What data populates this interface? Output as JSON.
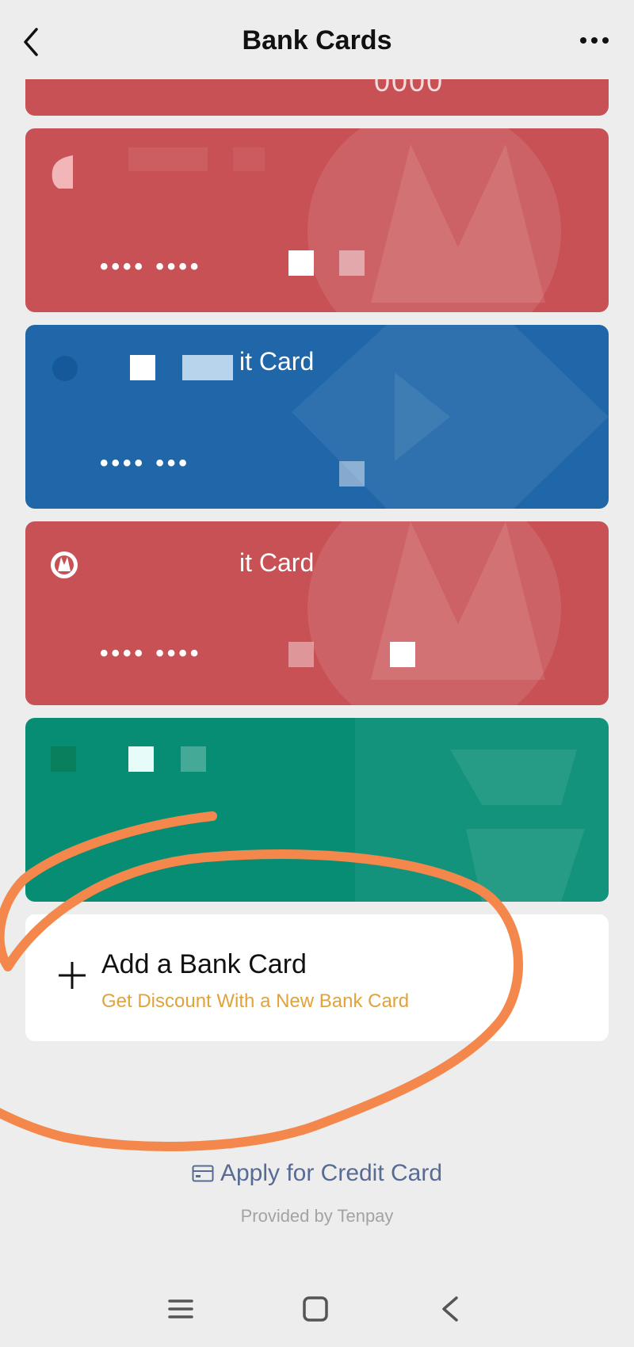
{
  "header": {
    "title": "Bank Cards",
    "back_icon": "chevron-left-icon",
    "more_icon": "more-dots-icon"
  },
  "top_sliver": {
    "text": "0000",
    "color": "#c85155"
  },
  "cards": [
    {
      "name": "",
      "number": "•••• ••••",
      "color": "#c85155"
    },
    {
      "name": "it Card",
      "number": "•••• •••",
      "color": "#1f67a8"
    },
    {
      "name": "it Card",
      "number": "•••• ••••",
      "color": "#c85155"
    },
    {
      "name": "",
      "number": "",
      "color": "#068d74"
    }
  ],
  "add_card": {
    "title": "Add a Bank Card",
    "subtitle": "Get Discount With a New Bank Card",
    "icon": "plus-icon"
  },
  "apply": {
    "label": "Apply for Credit Card",
    "icon": "credit-card-icon"
  },
  "provided_by": "Provided by Tenpay",
  "system_nav": {
    "menu_icon": "menu-icon",
    "home_icon": "home-square-icon",
    "back_icon": "back-triangle-icon"
  },
  "colors": {
    "background": "#ededed",
    "red_card": "#c85155",
    "blue_card": "#1f67a8",
    "green_card": "#068d74",
    "accent_orange": "#e0a33c",
    "link_blue": "#576b95",
    "scribble": "#f4874b"
  }
}
